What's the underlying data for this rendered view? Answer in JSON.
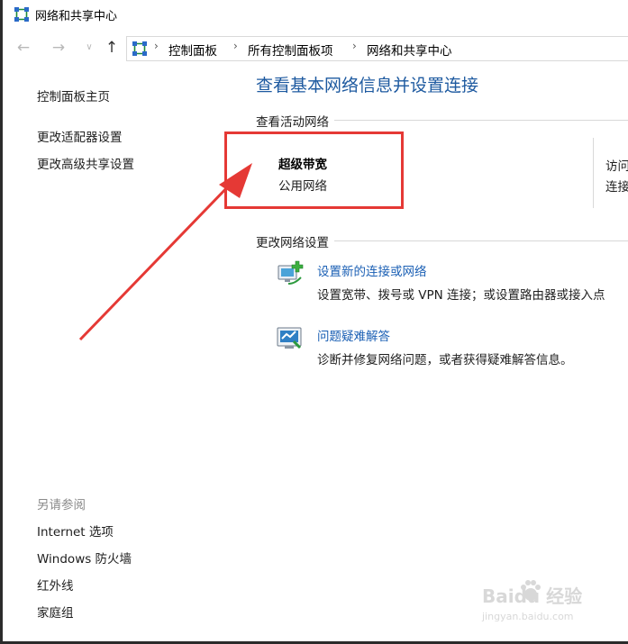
{
  "window": {
    "title": "网络和共享中心"
  },
  "breadcrumb": [
    "控制面板",
    "所有控制面板项",
    "网络和共享中心"
  ],
  "left_pane": {
    "home": "控制面板主页",
    "links": [
      "更改适配器设置",
      "更改高级共享设置"
    ],
    "see_also_header": "另请参阅",
    "see_also": [
      "Internet 选项",
      "Windows 防火墙",
      "红外线",
      "家庭组"
    ]
  },
  "main": {
    "title": "查看基本网络信息并设置连接",
    "active_networks_header": "查看活动网络",
    "network": {
      "name": "超级带宽",
      "type": "公用网络",
      "access_label": "访问",
      "connection_label": "连接"
    },
    "change_settings_header": "更改网络设置",
    "tasks": [
      {
        "title": "设置新的连接或网络",
        "description": "设置宽带、拨号或 VPN 连接；或设置路由器或接入点",
        "icon": "new-connection-icon"
      },
      {
        "title": "问题疑难解答",
        "description": "诊断并修复网络问题，或者获得疑难解答信息。",
        "icon": "troubleshoot-icon"
      }
    ]
  },
  "watermark": {
    "brand": "Baidu 经验",
    "url": "jingyan.baidu.com"
  },
  "colors": {
    "title_blue": "#1e5aa0",
    "link_blue": "#1a5fb4",
    "highlight_red": "#e53935"
  }
}
